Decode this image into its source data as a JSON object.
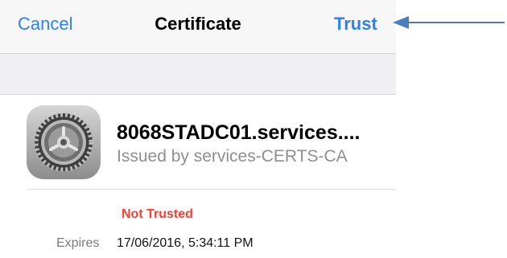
{
  "navbar": {
    "cancel_label": "Cancel",
    "title": "Certificate",
    "trust_label": "Trust"
  },
  "certificate": {
    "icon": "settings-gear-icon",
    "name": "8068STADC01.services....",
    "issuer": "Issued by services-CERTS-CA",
    "status": "Not Trusted",
    "expires_label": "Expires",
    "expires_value": "17/06/2016, 5:34:11 PM"
  },
  "annotation": {
    "icon": "arrow-left-icon"
  },
  "colors": {
    "accent": "#2f7ff5",
    "danger": "#ff3b30",
    "secondary_text": "#8e8e93",
    "group_background": "#efeff4",
    "arrow": "#4a7ebf"
  }
}
